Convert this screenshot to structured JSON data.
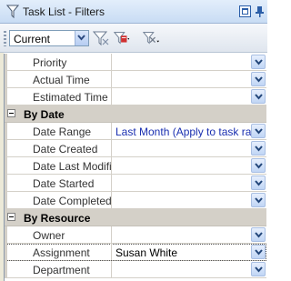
{
  "window": {
    "title": "Task List - Filters"
  },
  "toolbar": {
    "filter_value": "Current"
  },
  "grid": {
    "rows": [
      {
        "type": "prop",
        "label": "Priority",
        "value": ""
      },
      {
        "type": "prop",
        "label": "Actual Time",
        "value": ""
      },
      {
        "type": "prop",
        "label": "Estimated Time",
        "value": ""
      },
      {
        "type": "category",
        "label": "By Date"
      },
      {
        "type": "prop",
        "label": "Date Range",
        "value": "Last Month (Apply to task range)"
      },
      {
        "type": "prop",
        "label": "Date Created",
        "value": ""
      },
      {
        "type": "prop",
        "label": "Date Last Modified",
        "value": ""
      },
      {
        "type": "prop",
        "label": "Date Started",
        "value": ""
      },
      {
        "type": "prop",
        "label": "Date Completed",
        "value": ""
      },
      {
        "type": "category",
        "label": "By Resource"
      },
      {
        "type": "prop",
        "label": "Owner",
        "value": ""
      },
      {
        "type": "prop",
        "label": "Assignment",
        "value": "Susan White"
      },
      {
        "type": "prop",
        "label": "Department",
        "value": ""
      }
    ]
  },
  "colors": {
    "accent": "#2b5ea8",
    "value_blue": "#1a2fb0",
    "category_bg": "#d4d0c8"
  }
}
